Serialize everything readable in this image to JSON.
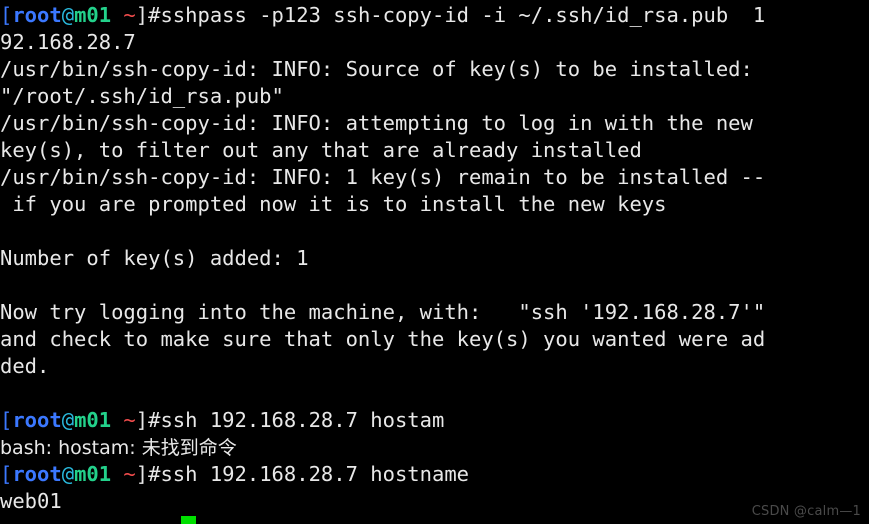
{
  "terminal": {
    "background_color": "#000000",
    "foreground_color": "#e8e8e8",
    "cursor_color": "#00e000",
    "prompt": {
      "bracket_open": "[",
      "user": "root",
      "at": "@",
      "host": "m01",
      "space_tilde": " ~",
      "bracket_close_hash": "]#",
      "colors": {
        "bracket": "#3b78ff",
        "user": "#3b78ff",
        "at": "#29b8db",
        "host": "#23d18b",
        "tilde": "#f14c4c",
        "end": "#e8e8e8"
      }
    },
    "lines": [
      {
        "type": "prompt",
        "command": "sshpass -p123 ssh-copy-id -i ~/.ssh/id_rsa.pub  1"
      },
      {
        "type": "output",
        "text": "92.168.28.7"
      },
      {
        "type": "output",
        "text": "/usr/bin/ssh-copy-id: INFO: Source of key(s) to be installed:"
      },
      {
        "type": "output",
        "text": "\"/root/.ssh/id_rsa.pub\""
      },
      {
        "type": "output",
        "text": "/usr/bin/ssh-copy-id: INFO: attempting to log in with the new"
      },
      {
        "type": "output",
        "text": "key(s), to filter out any that are already installed"
      },
      {
        "type": "output",
        "text": "/usr/bin/ssh-copy-id: INFO: 1 key(s) remain to be installed --"
      },
      {
        "type": "output",
        "text": " if you are prompted now it is to install the new keys"
      },
      {
        "type": "blank",
        "text": " "
      },
      {
        "type": "output",
        "text": "Number of key(s) added: 1"
      },
      {
        "type": "blank",
        "text": " "
      },
      {
        "type": "output",
        "text": "Now try logging into the machine, with:   \"ssh '192.168.28.7'\""
      },
      {
        "type": "output",
        "text": "and check to make sure that only the key(s) you wanted were ad"
      },
      {
        "type": "output",
        "text": "ded."
      },
      {
        "type": "blank",
        "text": " "
      },
      {
        "type": "prompt",
        "command": "ssh 192.168.28.7 hostam"
      },
      {
        "type": "output-cjk",
        "text": "bash: hostam: 未找到命令"
      },
      {
        "type": "prompt",
        "command": "ssh 192.168.28.7 hostname"
      },
      {
        "type": "output",
        "text": "web01"
      }
    ]
  },
  "watermark": {
    "text": "CSDN @calm—1",
    "color": "#4a4a4a"
  }
}
